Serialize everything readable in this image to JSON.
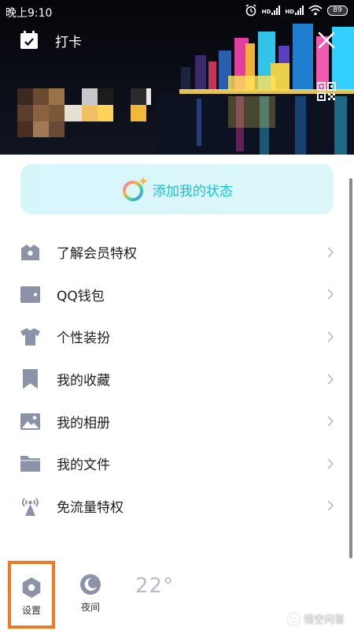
{
  "status_bar": {
    "time": "晚上9:10",
    "hd_label_1": "HD",
    "hd_label_2": "HD",
    "battery": "89",
    "icons": [
      "alarm-icon",
      "signal-icon",
      "signal-icon",
      "wifi-icon",
      "battery-icon"
    ]
  },
  "header": {
    "checkin_label": "打卡",
    "icons": [
      "calendar-check-icon",
      "close-icon",
      "qr-code-icon"
    ]
  },
  "status_prompt": {
    "label": "添加我的状态",
    "icon": "status-ring-icon"
  },
  "menu": {
    "items": [
      {
        "label": "了解会员特权",
        "icon": "vip-crown-icon"
      },
      {
        "label": "QQ钱包",
        "icon": "wallet-icon"
      },
      {
        "label": "个性装扮",
        "icon": "shirt-icon"
      },
      {
        "label": "我的收藏",
        "icon": "bookmark-icon"
      },
      {
        "label": "我的相册",
        "icon": "photo-icon"
      },
      {
        "label": "我的文件",
        "icon": "folder-icon"
      },
      {
        "label": "免流量特权",
        "icon": "signal-tower-icon"
      }
    ]
  },
  "bottom_bar": {
    "settings_label": "设置",
    "night_label": "夜间",
    "temperature": "22°"
  },
  "watermark": "悟空问答",
  "colors": {
    "accent_cyan": "#17c2d8",
    "status_box_bg": "#d7f6fb",
    "menu_icon": "#8c93a8",
    "highlight_border": "#f07a22"
  }
}
